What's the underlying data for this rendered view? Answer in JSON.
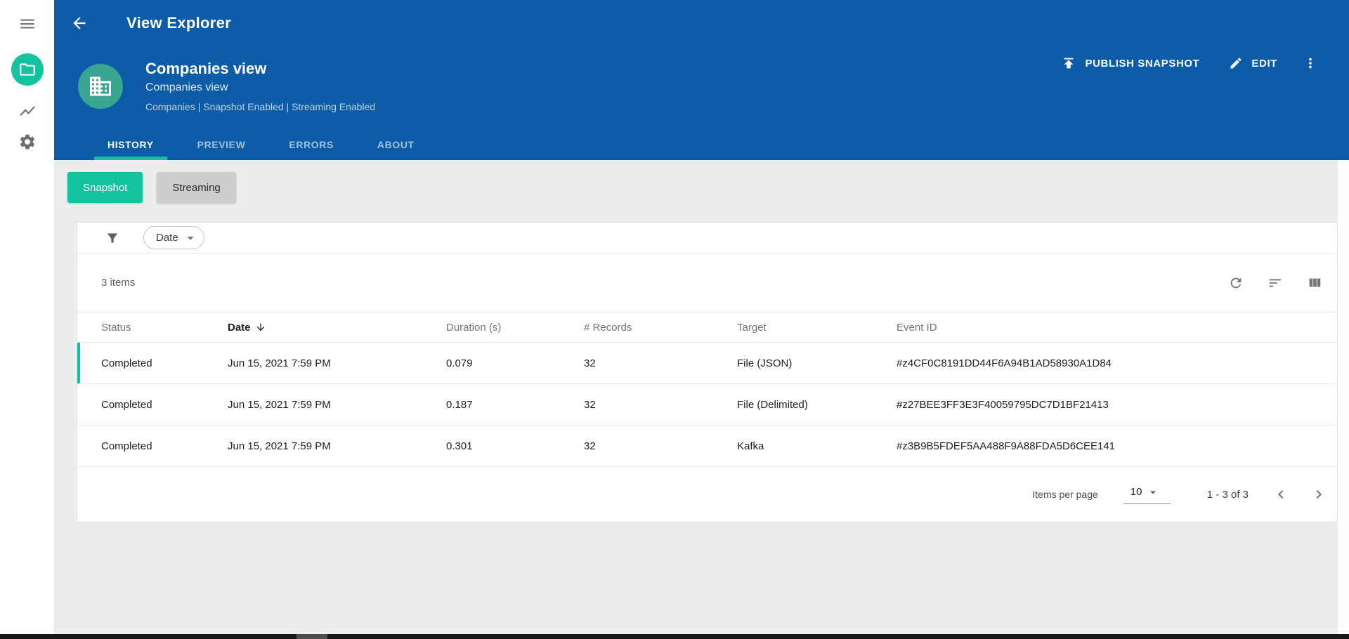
{
  "app": {
    "title": "View Explorer"
  },
  "colors": {
    "header_blue": "#0c5ca8",
    "accent_teal": "#13c3a0",
    "avatar_green": "#3aa591"
  },
  "view": {
    "title": "Companies view",
    "subtitle": "Companies view",
    "meta": "Companies | Snapshot Enabled | Streaming Enabled"
  },
  "actions": {
    "publish": "PUBLISH SNAPSHOT",
    "edit": "EDIT"
  },
  "tabs": [
    {
      "label": "HISTORY",
      "active": true
    },
    {
      "label": "PREVIEW",
      "active": false
    },
    {
      "label": "ERRORS",
      "active": false
    },
    {
      "label": "ABOUT",
      "active": false
    }
  ],
  "modes": [
    {
      "label": "Snapshot",
      "active": true
    },
    {
      "label": "Streaming",
      "active": false
    }
  ],
  "filter": {
    "chip": "Date"
  },
  "list": {
    "count_label": "3 items",
    "columns": [
      "Status",
      "Date",
      "Duration (s)",
      "# Records",
      "Target",
      "Event ID"
    ],
    "sorted_column": "Date",
    "sort_direction": "desc",
    "rows": [
      {
        "status": "Completed",
        "date": "Jun 15, 2021 7:59 PM",
        "duration_s": "0.079",
        "records": "32",
        "target": "File (JSON)",
        "event_id": "#z4CF0C8191DD44F6A94B1AD58930A1D84"
      },
      {
        "status": "Completed",
        "date": "Jun 15, 2021 7:59 PM",
        "duration_s": "0.187",
        "records": "32",
        "target": "File (Delimited)",
        "event_id": "#z27BEE3FF3E3F40059795DC7D1BF21413"
      },
      {
        "status": "Completed",
        "date": "Jun 15, 2021 7:59 PM",
        "duration_s": "0.301",
        "records": "32",
        "target": "Kafka",
        "event_id": "#z3B9B5FDEF5AA488F9A88FDA5D6CEE141"
      }
    ]
  },
  "pagination": {
    "items_per_page_label": "Items per page",
    "page_size": "10",
    "range_label": "1 - 3 of 3"
  },
  "icons": {
    "menu": "hamburger",
    "views_nav": "folder",
    "metrics_nav": "line-chart",
    "settings_nav": "gear",
    "back": "arrow-left",
    "avatar": "buildings",
    "publish": "upload",
    "edit": "pencil",
    "overflow": "vertical-dots",
    "filter": "funnel",
    "refresh": "circular-arrow",
    "sort": "sort-lines",
    "columns": "column-bars",
    "sort_indicator": "arrow-down",
    "dropdown": "caret-down",
    "prev": "chevron-left",
    "next": "chevron-right"
  }
}
